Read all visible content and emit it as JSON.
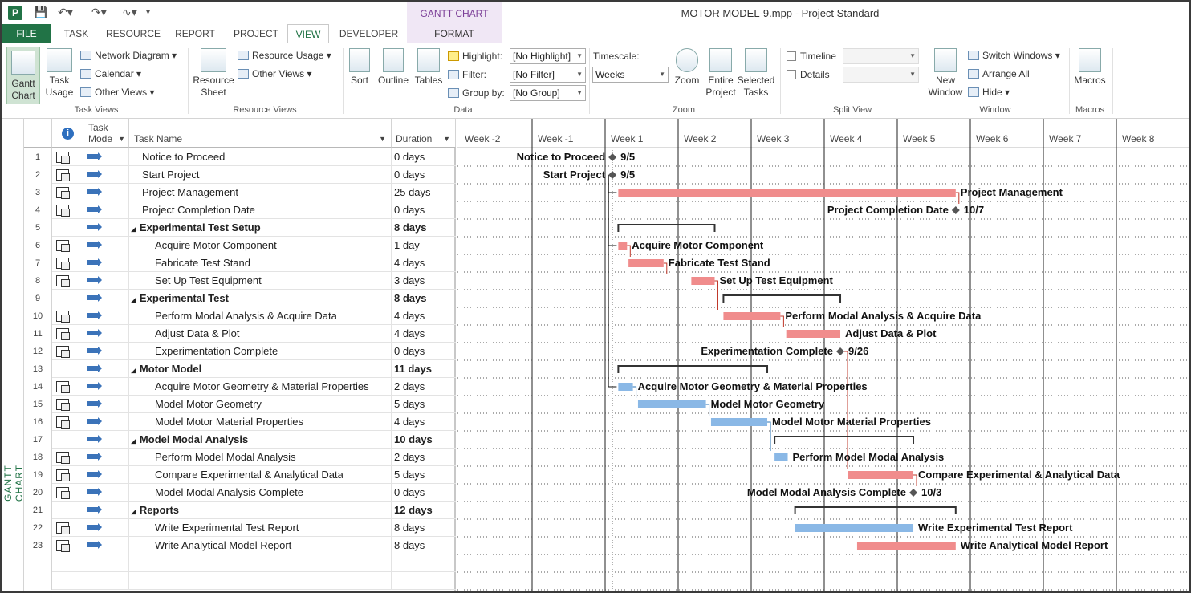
{
  "app": {
    "icon_letter": "P",
    "title": "MOTOR MODEL-9.mpp - Project Standard",
    "contextual_group": "GANTT CHART TOOLS"
  },
  "tabs": [
    "FILE",
    "TASK",
    "RESOURCE",
    "REPORT",
    "PROJECT",
    "VIEW",
    "DEVELOPER",
    "FORMAT"
  ],
  "ribbon": {
    "task_views": {
      "label": "Task Views",
      "gantt": "Gantt Chart",
      "task_usage": "Task Usage",
      "network_diagram": "Network Diagram",
      "calendar": "Calendar",
      "other_views": "Other Views"
    },
    "resource_views": {
      "label": "Resource Views",
      "resource_sheet": "Resource Sheet",
      "resource_usage": "Resource Usage",
      "other_views": "Other Views"
    },
    "data": {
      "label": "Data",
      "sort": "Sort",
      "outline": "Outline",
      "tables": "Tables",
      "highlight": "Highlight:",
      "highlight_value": "[No Highlight]",
      "filter": "Filter:",
      "filter_value": "[No Filter]",
      "group_by": "Group by:",
      "group_value": "[No Group]"
    },
    "zoom": {
      "label": "Zoom",
      "timescale": "Timescale:",
      "timescale_value": "Weeks",
      "zoom": "Zoom",
      "entire_project": "Entire Project",
      "selected_tasks": "Selected Tasks"
    },
    "split_view": {
      "label": "Split View",
      "timeline": "Timeline",
      "details": "Details"
    },
    "window": {
      "label": "Window",
      "new_window": "New Window",
      "switch_windows": "Switch Windows",
      "arrange_all": "Arrange All",
      "hide": "Hide"
    },
    "macros": {
      "label": "Macros",
      "macros": "Macros"
    }
  },
  "sidebar_label": "GANTT CHART",
  "columns": {
    "task_mode": "Task Mode",
    "task_name": "Task Name",
    "duration": "Duration"
  },
  "tasks": [
    {
      "id": "1",
      "name": "Notice to Proceed",
      "duration": "0 days",
      "level": 1,
      "summary": false
    },
    {
      "id": "2",
      "name": "Start Project",
      "duration": "0 days",
      "level": 1,
      "summary": false
    },
    {
      "id": "3",
      "name": "Project Management",
      "duration": "25 days",
      "level": 1,
      "summary": false
    },
    {
      "id": "4",
      "name": "Project Completion Date",
      "duration": "0 days",
      "level": 1,
      "summary": false
    },
    {
      "id": "5",
      "name": "Experimental Test Setup",
      "duration": "8 days",
      "level": 1,
      "summary": true
    },
    {
      "id": "6",
      "name": "Acquire Motor Component",
      "duration": "1 day",
      "level": 2,
      "summary": false
    },
    {
      "id": "7",
      "name": "Fabricate Test Stand",
      "duration": "4 days",
      "level": 2,
      "summary": false
    },
    {
      "id": "8",
      "name": "Set Up Test Equipment",
      "duration": "3 days",
      "level": 2,
      "summary": false
    },
    {
      "id": "9",
      "name": "Experimental Test",
      "duration": "8 days",
      "level": 1,
      "summary": true
    },
    {
      "id": "10",
      "name": "Perform Modal Analysis & Acquire Data",
      "duration": "4 days",
      "level": 2,
      "summary": false
    },
    {
      "id": "11",
      "name": "Adjust Data & Plot",
      "duration": "4 days",
      "level": 2,
      "summary": false
    },
    {
      "id": "12",
      "name": "Experimentation Complete",
      "duration": "0 days",
      "level": 2,
      "summary": false
    },
    {
      "id": "13",
      "name": "Motor Model",
      "duration": "11 days",
      "level": 1,
      "summary": true
    },
    {
      "id": "14",
      "name": "Acquire Motor Geometry & Material Properties",
      "duration": "2 days",
      "level": 2,
      "summary": false
    },
    {
      "id": "15",
      "name": "Model Motor Geometry",
      "duration": "5 days",
      "level": 2,
      "summary": false
    },
    {
      "id": "16",
      "name": "Model Motor Material Properties",
      "duration": "4 days",
      "level": 2,
      "summary": false
    },
    {
      "id": "17",
      "name": "Model Modal Analysis",
      "duration": "10 days",
      "level": 1,
      "summary": true
    },
    {
      "id": "18",
      "name": "Perform Model Modal Analysis",
      "duration": "2 days",
      "level": 2,
      "summary": false
    },
    {
      "id": "19",
      "name": "Compare Experimental & Analytical Data",
      "duration": "5 days",
      "level": 2,
      "summary": false
    },
    {
      "id": "20",
      "name": "Model Modal Analysis Complete",
      "duration": "0 days",
      "level": 2,
      "summary": false
    },
    {
      "id": "21",
      "name": "Reports",
      "duration": "12 days",
      "level": 1,
      "summary": true
    },
    {
      "id": "22",
      "name": "Write Experimental Test Report",
      "duration": "8 days",
      "level": 2,
      "summary": false
    },
    {
      "id": "23",
      "name": "Write Analytical Model Report",
      "duration": "8 days",
      "level": 2,
      "summary": false
    }
  ],
  "timescale": {
    "weeks": [
      "Week -2",
      "Week -1",
      "Week 1",
      "Week 2",
      "Week 3",
      "Week 4",
      "Week 5",
      "Week 6",
      "Week 7",
      "Week 8"
    ]
  },
  "chart_data": {
    "type": "gantt",
    "time_unit": "weeks (week 1 starts at 0)",
    "colors": {
      "critical": "#f08c8c",
      "normal": "#8ab8e6",
      "summary": "#333333",
      "milestone": "#555555",
      "link_critical": "#c0392b",
      "link_normal": "#2e75b6"
    },
    "bars": [
      {
        "row": 1,
        "kind": "milestone",
        "start": 0.1,
        "label": "Notice to Proceed",
        "date": "9/5",
        "label_side": "left"
      },
      {
        "row": 2,
        "kind": "milestone",
        "start": 0.1,
        "label": "Start Project",
        "date": "9/5",
        "label_side": "left"
      },
      {
        "row": 3,
        "kind": "task",
        "start": 0.18,
        "end": 4.8,
        "critical": true,
        "label": "Project Management"
      },
      {
        "row": 4,
        "kind": "milestone",
        "start": 4.8,
        "label": "Project Completion Date",
        "date": "10/7",
        "label_side": "left"
      },
      {
        "row": 5,
        "kind": "summary",
        "start": 0.18,
        "end": 1.5
      },
      {
        "row": 6,
        "kind": "task",
        "start": 0.18,
        "end": 0.3,
        "critical": true,
        "label": "Acquire Motor Component"
      },
      {
        "row": 7,
        "kind": "task",
        "start": 0.32,
        "end": 0.8,
        "critical": true,
        "label": "Fabricate Test Stand"
      },
      {
        "row": 8,
        "kind": "task",
        "start": 1.18,
        "end": 1.5,
        "critical": true,
        "label": "Set Up Test Equipment"
      },
      {
        "row": 9,
        "kind": "summary",
        "start": 1.62,
        "end": 3.22
      },
      {
        "row": 10,
        "kind": "task",
        "start": 1.62,
        "end": 2.4,
        "critical": true,
        "label": "Perform Modal Analysis & Acquire Data"
      },
      {
        "row": 11,
        "kind": "task",
        "start": 2.48,
        "end": 3.22,
        "critical": true,
        "label": "Adjust Data & Plot"
      },
      {
        "row": 12,
        "kind": "milestone",
        "start": 3.22,
        "label": "Experimentation Complete",
        "date": "9/26",
        "label_side": "left"
      },
      {
        "row": 13,
        "kind": "summary",
        "start": 0.18,
        "end": 2.22
      },
      {
        "row": 14,
        "kind": "task",
        "start": 0.18,
        "end": 0.38,
        "critical": false,
        "label": "Acquire Motor Geometry & Material Properties"
      },
      {
        "row": 15,
        "kind": "task",
        "start": 0.45,
        "end": 1.38,
        "critical": false,
        "label": "Model Motor Geometry"
      },
      {
        "row": 16,
        "kind": "task",
        "start": 1.45,
        "end": 2.22,
        "critical": false,
        "label": "Model Motor Material Properties"
      },
      {
        "row": 17,
        "kind": "summary",
        "start": 2.32,
        "end": 4.22
      },
      {
        "row": 18,
        "kind": "task",
        "start": 2.32,
        "end": 2.5,
        "critical": false,
        "label": "Perform Model Modal Analysis"
      },
      {
        "row": 19,
        "kind": "task",
        "start": 3.32,
        "end": 4.22,
        "critical": true,
        "label": "Compare Experimental & Analytical Data"
      },
      {
        "row": 20,
        "kind": "milestone",
        "start": 4.22,
        "label": "Model Modal Analysis Complete",
        "date": "10/3",
        "label_side": "left"
      },
      {
        "row": 21,
        "kind": "summary",
        "start": 2.6,
        "end": 4.8
      },
      {
        "row": 22,
        "kind": "task",
        "start": 2.6,
        "end": 4.22,
        "critical": false,
        "label": "Write Experimental Test Report"
      },
      {
        "row": 23,
        "kind": "task",
        "start": 3.45,
        "end": 4.8,
        "critical": true,
        "label": "Write Analytical Model Report"
      }
    ],
    "links": [
      {
        "from": 2,
        "to": 3,
        "critical": true
      },
      {
        "from": 2,
        "to": 6,
        "critical": true
      },
      {
        "from": 2,
        "to": 14,
        "critical": true
      },
      {
        "from": 6,
        "to": 7,
        "critical": true
      },
      {
        "from": 7,
        "to": 8,
        "critical": true
      },
      {
        "from": 8,
        "to": 10,
        "critical": true
      },
      {
        "from": 10,
        "to": 11,
        "critical": true
      },
      {
        "from": 14,
        "to": 15,
        "critical": false
      },
      {
        "from": 15,
        "to": 16,
        "critical": false
      },
      {
        "from": 16,
        "to": 18,
        "critical": false
      },
      {
        "from": 12,
        "to": 19,
        "critical": true
      },
      {
        "from": 19,
        "to": 20,
        "critical": true
      },
      {
        "from": 3,
        "to": 4,
        "critical": true
      }
    ]
  }
}
